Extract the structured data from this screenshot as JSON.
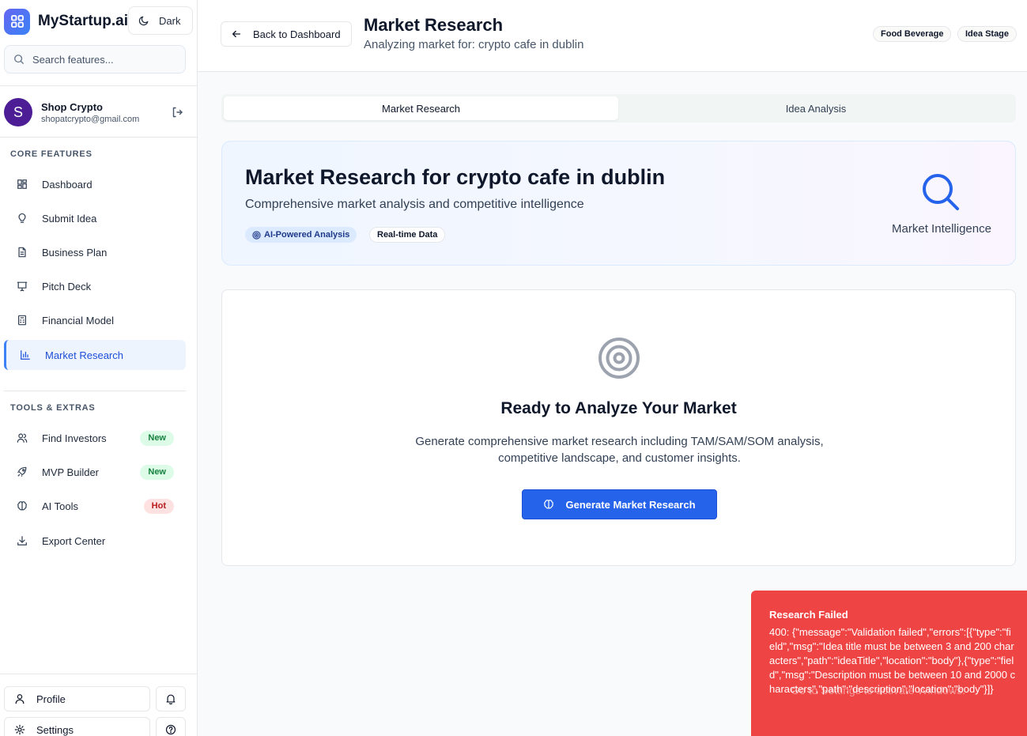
{
  "sidebar": {
    "brand": "MyStartup.ai",
    "theme_button": "Dark",
    "search_placeholder": "Search features...",
    "user": {
      "initial": "S",
      "name": "Shop Crypto",
      "email": "shopatcrypto@gmail.com"
    },
    "core_title": "CORE FEATURES",
    "core_items": [
      {
        "label": "Dashboard",
        "icon": "dashboard-icon"
      },
      {
        "label": "Submit Idea",
        "icon": "lightbulb-icon"
      },
      {
        "label": "Business Plan",
        "icon": "document-icon"
      },
      {
        "label": "Pitch Deck",
        "icon": "presentation-icon"
      },
      {
        "label": "Financial Model",
        "icon": "calculator-icon"
      },
      {
        "label": "Market Research",
        "icon": "bar-chart-icon",
        "active": true
      }
    ],
    "tools_title": "TOOLS & EXTRAS",
    "tools_items": [
      {
        "label": "Find Investors",
        "icon": "users-icon",
        "badge": "New"
      },
      {
        "label": "MVP Builder",
        "icon": "rocket-icon",
        "badge": "New"
      },
      {
        "label": "AI Tools",
        "icon": "brain-icon",
        "badge": "Hot"
      },
      {
        "label": "Export Center",
        "icon": "download-icon"
      }
    ],
    "profile_label": "Profile",
    "settings_label": "Settings"
  },
  "header": {
    "back_label": "Back to Dashboard",
    "title": "Market Research",
    "subtitle": "Analyzing market for: crypto cafe in dublin",
    "tags": [
      "Food Beverage",
      "Idea Stage"
    ]
  },
  "tabs": [
    "Market Research",
    "Idea Analysis"
  ],
  "hero": {
    "title": "Market Research for crypto cafe in dublin",
    "subtitle": "Comprehensive market analysis and competitive intelligence",
    "pill_ai": "AI-Powered Analysis",
    "pill_rt": "Real-time Data",
    "icon_label": "Market Intelligence"
  },
  "panel": {
    "title": "Ready to Analyze Your Market",
    "description": "Generate comprehensive market research including TAM/SAM/SOM analysis, competitive landscape, and customer insights.",
    "button": "Generate Market Research"
  },
  "toast": {
    "title": "Research Failed",
    "body": "400: {\"message\":\"Validation failed\",\"errors\":[{\"type\":\"field\",\"msg\":\"Idea title must be between 3 and 200 characters\",\"path\":\"ideaTitle\",\"location\":\"body\"},{\"type\":\"field\",\"msg\":\"Description must be between 10 and 2000 characters\",\"path\":\"description\",\"location\":\"body\"}]}"
  },
  "watermark": "Go to Settings to activate Windows.",
  "colors": {
    "accent": "#2563eb",
    "toast": "#ef4444",
    "active_nav_bg": "#eef4fe"
  }
}
